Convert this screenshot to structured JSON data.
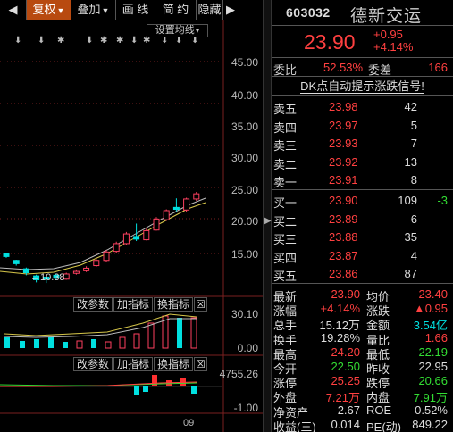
{
  "toolbar": {
    "fuquan": "复权",
    "diejia": "叠加",
    "hualine": "画 线",
    "jianyue": "简 约",
    "yincang": "隐藏"
  },
  "chart": {
    "setting_label": "设置均线",
    "y_ticks": [
      "45.00",
      "40.00",
      "35.00",
      "30.00",
      "25.00",
      "20.00",
      "15.00"
    ],
    "low_mark": "←10.38",
    "sub1": {
      "btn1": "改参数",
      "btn2": "加指标",
      "btn3": "换指标",
      "close": "☒",
      "y_top": "30.10",
      "y_bottom": "0.00"
    },
    "sub2": {
      "btn1": "改参数",
      "btn2": "加指标",
      "btn3": "换指标",
      "y_top": "4755.26",
      "y_bottom": "-1.00"
    },
    "x_label": "09"
  },
  "chart_data": {
    "type": "candlestick",
    "ylim": [
      10,
      47
    ],
    "candles": [
      {
        "o": 14.9,
        "c": 14.5,
        "h": 15.1,
        "l": 14.3
      },
      {
        "o": 13.9,
        "c": 13.4,
        "h": 14.0,
        "l": 13.1
      },
      {
        "o": 12.6,
        "c": 12.0,
        "h": 12.8,
        "l": 11.6
      },
      {
        "o": 11.5,
        "c": 10.9,
        "h": 11.7,
        "l": 10.5
      },
      {
        "o": 11.3,
        "c": 11.0,
        "h": 11.6,
        "l": 10.4
      },
      {
        "o": 11.6,
        "c": 11.3,
        "h": 11.8,
        "l": 10.9
      },
      {
        "o": 11.0,
        "c": 11.8,
        "h": 12.0,
        "l": 10.9
      },
      {
        "o": 11.9,
        "c": 12.2,
        "h": 12.5,
        "l": 11.7
      },
      {
        "o": 12.3,
        "c": 12.7,
        "h": 13.0,
        "l": 12.1
      },
      {
        "o": 13.1,
        "c": 13.9,
        "h": 14.2,
        "l": 12.9
      },
      {
        "o": 13.9,
        "c": 15.2,
        "h": 15.5,
        "l": 13.7
      },
      {
        "o": 15.3,
        "c": 16.5,
        "h": 16.8,
        "l": 15.1
      },
      {
        "o": 16.5,
        "c": 18.0,
        "h": 18.3,
        "l": 16.3
      },
      {
        "o": 17.6,
        "c": 17.2,
        "h": 19.6,
        "l": 16.9
      },
      {
        "o": 17.1,
        "c": 18.5,
        "h": 18.8,
        "l": 17.0
      },
      {
        "o": 18.6,
        "c": 20.3,
        "h": 20.6,
        "l": 18.5
      },
      {
        "o": 20.2,
        "c": 21.6,
        "h": 21.8,
        "l": 20.0
      },
      {
        "o": 22.1,
        "c": 21.8,
        "h": 23.5,
        "l": 21.5
      },
      {
        "o": 21.7,
        "c": 23.4,
        "h": 23.6,
        "l": 21.4
      },
      {
        "o": 23.4,
        "c": 24.2,
        "h": 24.5,
        "l": 23.1
      }
    ]
  },
  "quote": {
    "code": "603032",
    "name": "德新交运",
    "last": "23.90",
    "chg": "+0.95",
    "chg_pct": "+4.14%",
    "weibi_label": "委比",
    "weibi": "52.53%",
    "weicha_label": "委差",
    "weicha": "166",
    "notice": "DK点自动提示涨跌信号!",
    "asks": [
      {
        "label": "卖五",
        "price": "23.98",
        "vol": "42"
      },
      {
        "label": "卖四",
        "price": "23.97",
        "vol": "5"
      },
      {
        "label": "卖三",
        "price": "23.93",
        "vol": "7"
      },
      {
        "label": "卖二",
        "price": "23.92",
        "vol": "13"
      },
      {
        "label": "卖一",
        "price": "23.91",
        "vol": "8"
      }
    ],
    "bids": [
      {
        "label": "买一",
        "price": "23.90",
        "vol": "109",
        "extra": "-3"
      },
      {
        "label": "买二",
        "price": "23.89",
        "vol": "6",
        "extra": ""
      },
      {
        "label": "买三",
        "price": "23.88",
        "vol": "35",
        "extra": ""
      },
      {
        "label": "买四",
        "price": "23.87",
        "vol": "4",
        "extra": ""
      },
      {
        "label": "买五",
        "price": "23.86",
        "vol": "87",
        "extra": ""
      }
    ],
    "stats": [
      {
        "l1": "最新",
        "v1": "23.90",
        "c1": "red",
        "l2": "均价",
        "v2": "23.40",
        "c2": "red"
      },
      {
        "l1": "涨幅",
        "v1": "+4.14%",
        "c1": "red",
        "l2": "涨跌",
        "v2": "▲0.95",
        "c2": "red"
      },
      {
        "l1": "总手",
        "v1": "15.12万",
        "c1": "white",
        "l2": "金额",
        "v2": "3.54亿",
        "c2": "cyan"
      },
      {
        "l1": "换手",
        "v1": "19.28%",
        "c1": "white",
        "l2": "量比",
        "v2": "1.66",
        "c2": "red"
      },
      {
        "l1": "最高",
        "v1": "24.20",
        "c1": "red",
        "l2": "最低",
        "v2": "22.19",
        "c2": "green"
      },
      {
        "l1": "今开",
        "v1": "22.50",
        "c1": "green",
        "l2": "昨收",
        "v2": "22.95",
        "c2": "white"
      },
      {
        "l1": "涨停",
        "v1": "25.25",
        "c1": "red",
        "l2": "跌停",
        "v2": "20.66",
        "c2": "green"
      },
      {
        "l1": "外盘",
        "v1": "7.21万",
        "c1": "red",
        "l2": "内盘",
        "v2": "7.91万",
        "c2": "green"
      },
      {
        "l1": "净资产",
        "v1": "2.67",
        "c1": "white",
        "l2": "ROE",
        "v2": "0.52%",
        "c2": "white"
      },
      {
        "l1": "收益(三)",
        "v1": "0.014",
        "c1": "white",
        "l2": "PE(动)",
        "v2": "849.22",
        "c2": "white"
      }
    ]
  }
}
